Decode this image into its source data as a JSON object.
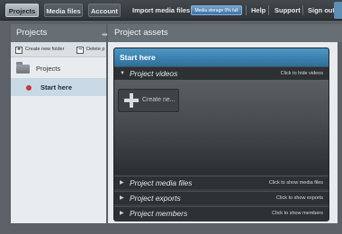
{
  "topnav": {
    "tabs": [
      {
        "label": "Projects",
        "active": true
      },
      {
        "label": "Media files",
        "active": false
      },
      {
        "label": "Account",
        "active": false
      }
    ],
    "import_label": "Import media files",
    "storage_badge": "Media storage 0% full",
    "links": [
      "Help",
      "Support",
      "Sign out"
    ]
  },
  "left_pane": {
    "title": "Projects",
    "toolbar": {
      "create_label": "Create new folder",
      "delete_label": "Delete p"
    },
    "folder_label": "Projects",
    "items": [
      {
        "label": "Start here",
        "selected": true
      }
    ]
  },
  "right_pane": {
    "title": "Project assets",
    "panel_title": "Start here",
    "sections": [
      {
        "title": "Project videos",
        "hint": "Click to hide videos",
        "expanded": true
      },
      {
        "title": "Project media files",
        "hint": "Click to show media files",
        "expanded": false
      },
      {
        "title": "Project exports",
        "hint": "Click to show exports",
        "expanded": false
      },
      {
        "title": "Project members",
        "hint": "Click to show members",
        "expanded": false
      }
    ],
    "create_label": "Create ne..."
  },
  "colors": {
    "accent": "#3f7fb0",
    "active_dot": "#c53a3a",
    "storage_badge": "#4a7fb0"
  }
}
